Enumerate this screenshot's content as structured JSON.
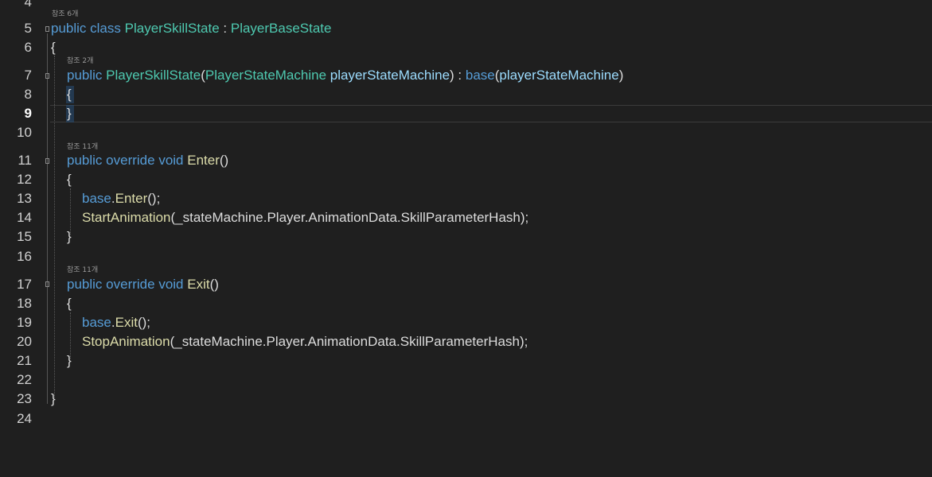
{
  "editor": {
    "lines": [
      {
        "n": "4"
      },
      {
        "n": "5"
      },
      {
        "n": "6"
      },
      {
        "n": "7"
      },
      {
        "n": "8"
      },
      {
        "n": "9"
      },
      {
        "n": "10"
      },
      {
        "n": "11"
      },
      {
        "n": "12"
      },
      {
        "n": "13"
      },
      {
        "n": "14"
      },
      {
        "n": "15"
      },
      {
        "n": "16"
      },
      {
        "n": "17"
      },
      {
        "n": "18"
      },
      {
        "n": "19"
      },
      {
        "n": "20"
      },
      {
        "n": "21"
      },
      {
        "n": "22"
      },
      {
        "n": "23"
      },
      {
        "n": "24"
      }
    ],
    "current_line": "9",
    "codelens": {
      "class_refs": "참조 6개",
      "ctor_refs": "참조 2개",
      "enter_refs": "참조 11개",
      "exit_refs": "참조 11개"
    },
    "tokens": {
      "kw_public": "public",
      "kw_class": "class",
      "cls_name": "PlayerSkillState",
      "colon": " : ",
      "base_type": "PlayerBaseState",
      "open_brace": "{",
      "close_brace": "}",
      "ctor_name": "PlayerSkillState",
      "paren_open": "(",
      "param_type": "PlayerStateMachine",
      "param_name": "playerStateMachine",
      "paren_close_colon": ") : ",
      "kw_base": "base",
      "paren_close": ")",
      "kw_override": "override",
      "kw_void": "void",
      "fn_enter": "Enter",
      "fn_exit": "Exit",
      "empty_parens": "()",
      "base_enter_call": "();",
      "dot": ".",
      "fn_start_anim": "StartAnimation",
      "fn_stop_anim": "StopAnimation",
      "anim_arg": "(_stateMachine.Player.AnimationData.SkillParameterHash);"
    }
  },
  "colors": {
    "background": "#1f1f1f",
    "keyword": "#569cd6",
    "type": "#4ec9b0",
    "function": "#dcdcaa",
    "parameter": "#9cdcfe",
    "punctuation": "#dcdcdc",
    "line_number": "#d0d0d0"
  }
}
